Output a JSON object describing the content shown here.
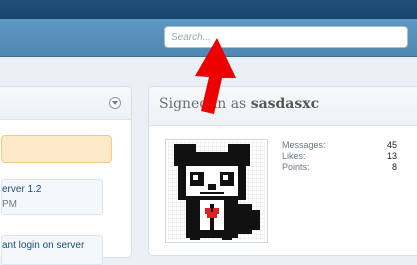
{
  "header": {
    "search": {
      "placeholder": "Search..."
    }
  },
  "left_panel": {
    "threads": [
      {
        "title": "erver 1.2",
        "meta": "PM"
      },
      {
        "title": "ant login on server",
        "meta": ""
      }
    ]
  },
  "account_panel": {
    "signed_in_prefix": "Signed in as",
    "username": "sasdasxc",
    "stats": [
      {
        "label": "Messages:",
        "value": "45"
      },
      {
        "label": "Likes:",
        "value": "13"
      },
      {
        "label": "Points:",
        "value": "8"
      }
    ]
  },
  "colors": {
    "topbar": "#1f4f7a",
    "navbar": "#5a93bf",
    "highlight": "#fde8c8",
    "arrow": "#ee0000"
  },
  "icons": {
    "collapse": "chevron-down-circle-icon",
    "annotation": "red-arrow-icon"
  }
}
